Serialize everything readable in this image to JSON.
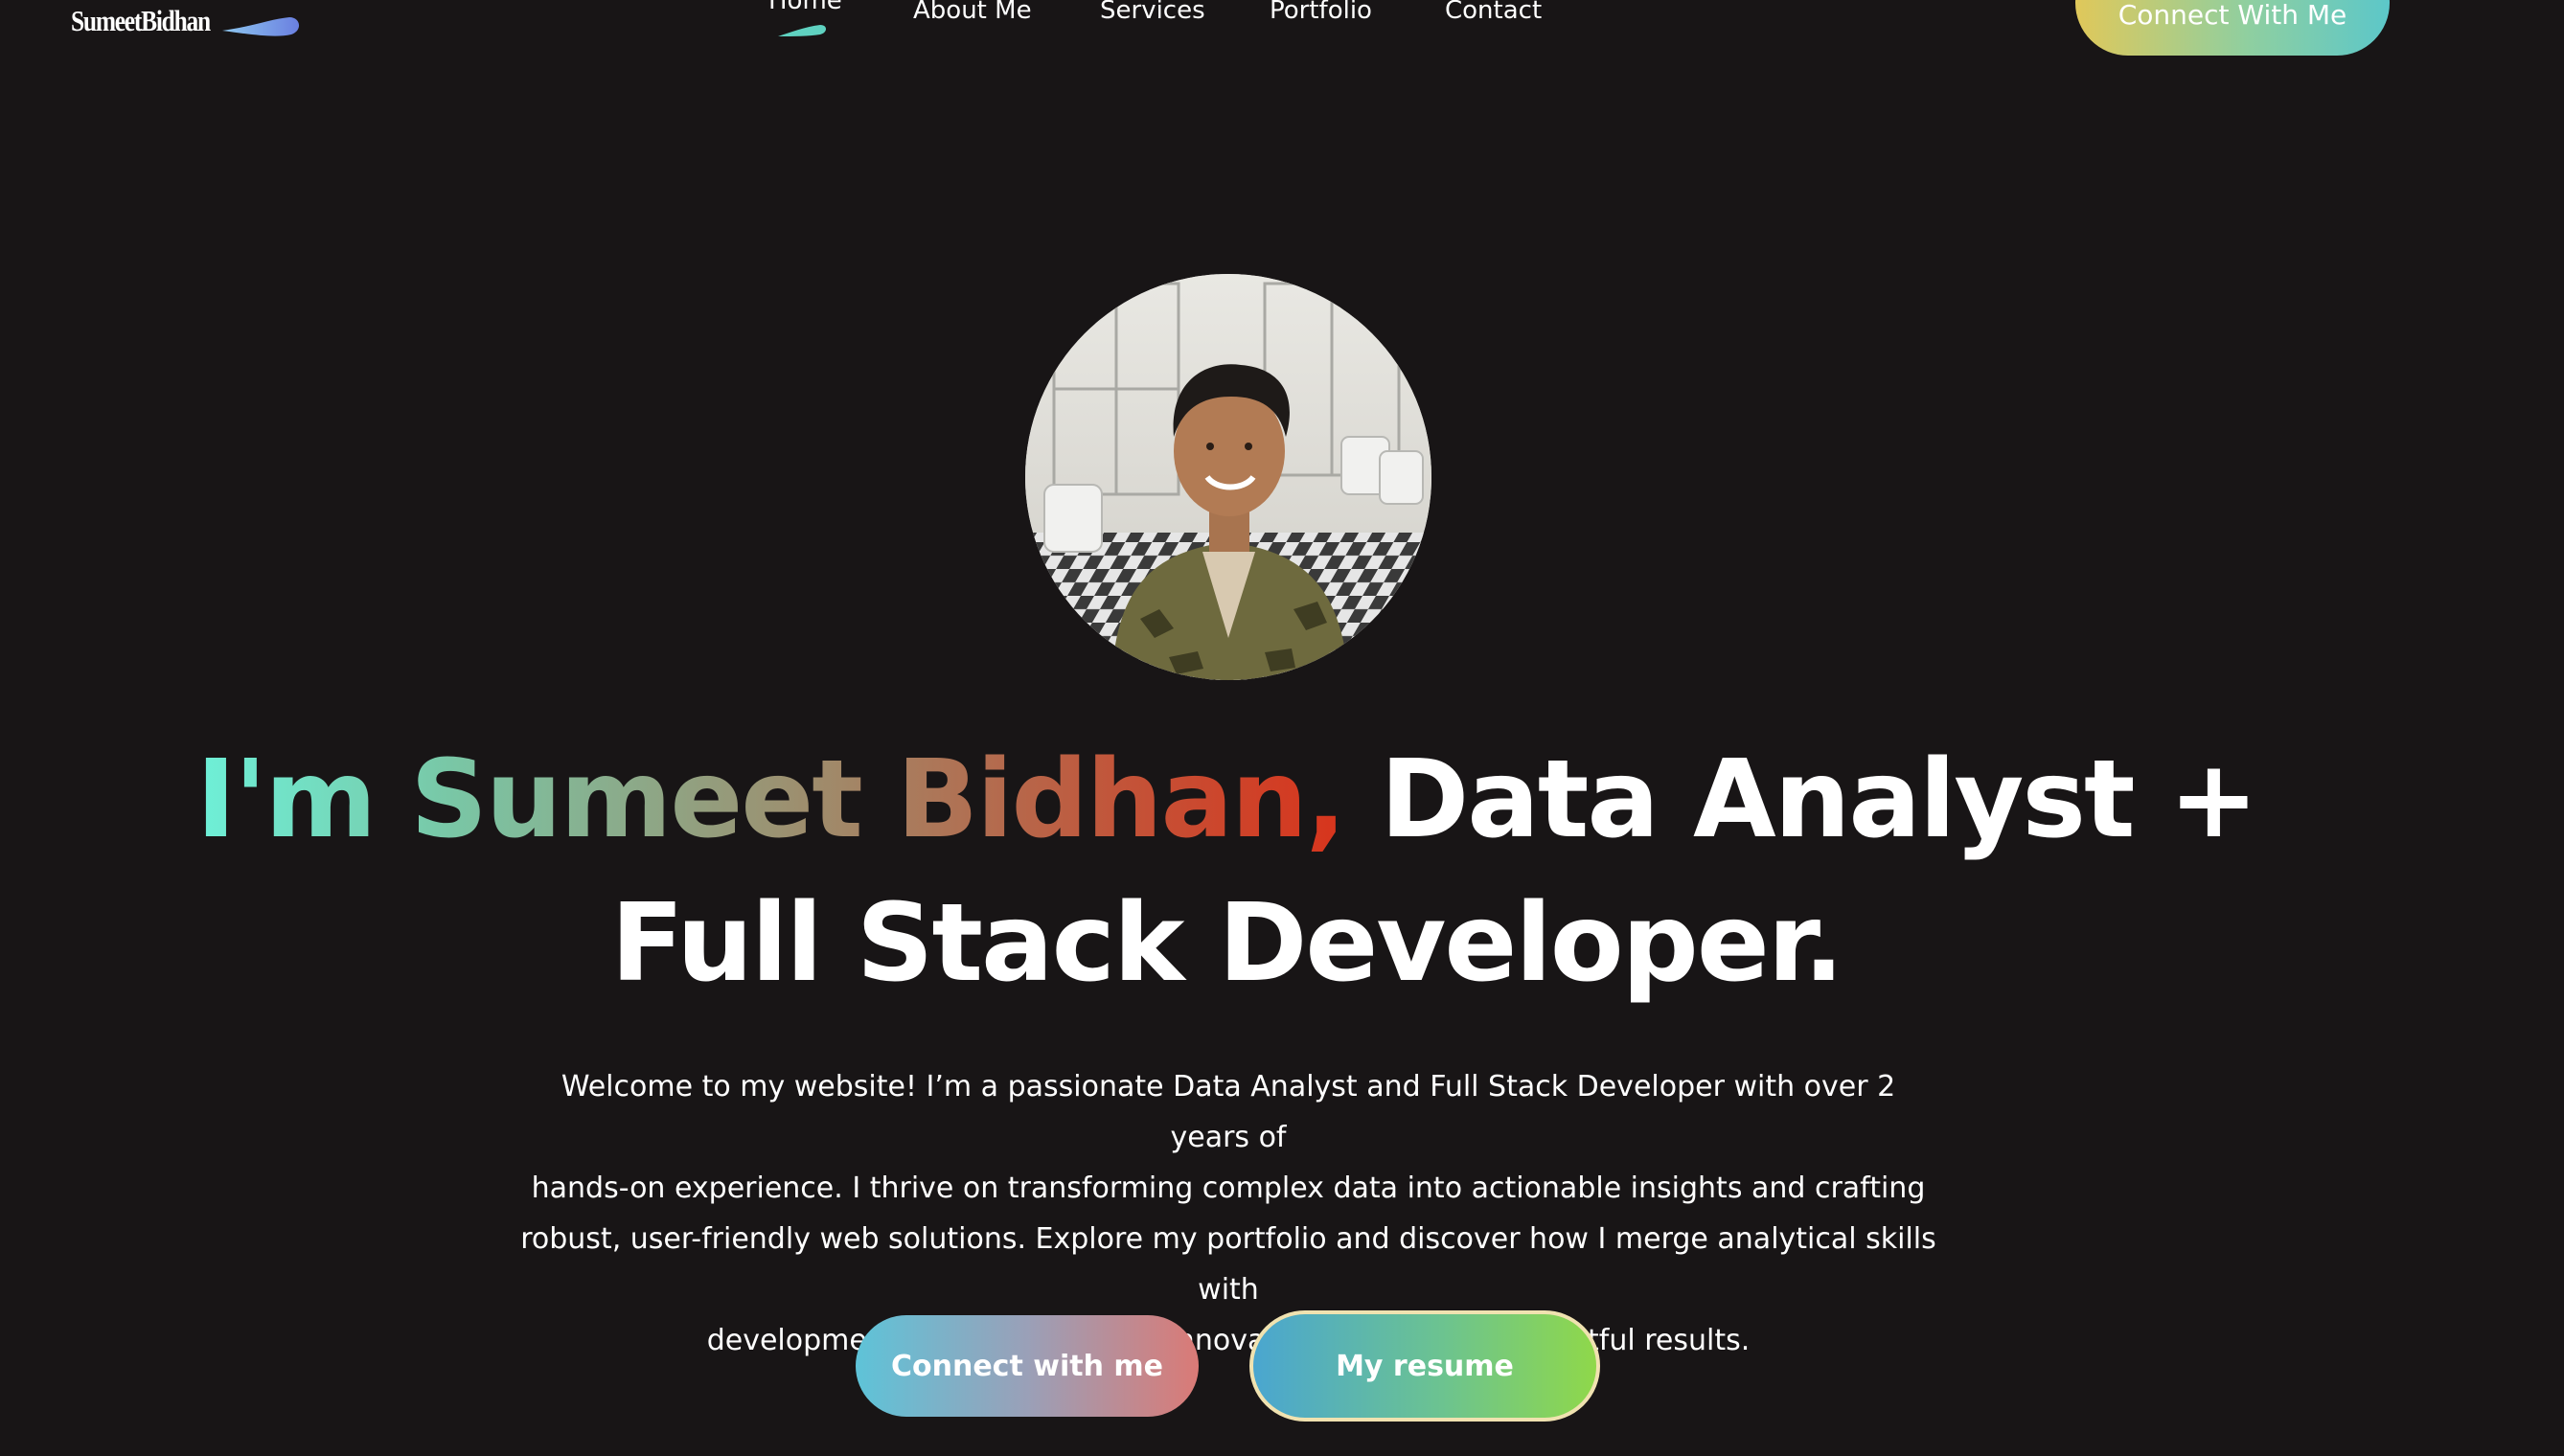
{
  "brand": {
    "logo_text": "SumeetBidhan"
  },
  "nav": {
    "items": [
      {
        "label": "Home",
        "active": true
      },
      {
        "label": "About Me"
      },
      {
        "label": "Services"
      },
      {
        "label": "Portfolio"
      },
      {
        "label": "Contact"
      }
    ],
    "cta_label": "Connect With Me"
  },
  "hero": {
    "headline_intro": "I'm Sumeet Bidhan,",
    "headline_role_1": "Data Analyst +",
    "headline_role_2": "Full Stack Developer.",
    "intro_line_1": "Welcome to my website! I’m a passionate Data Analyst and Full Stack Developer with over 2 years of",
    "intro_line_2": "hands-on experience. I thrive on transforming complex data into actionable insights and crafting",
    "intro_line_3": "robust, user-friendly web solutions. Explore my portfolio and discover how I merge analytical skills with",
    "intro_line_4": "development expertise to drive innovation and deliver impactful results.",
    "primary_button": "Connect with me",
    "secondary_button": "My resume"
  },
  "colors": {
    "background": "#181516",
    "name_gradient_start": "#6ef0d8",
    "name_gradient_end": "#d8341c",
    "accent_teal": "#5cc7c9",
    "accent_yellow": "#e0c85a"
  },
  "icons": {
    "logo_swoosh": "swoosh-icon",
    "home_underline": "underline-swoosh-icon"
  }
}
